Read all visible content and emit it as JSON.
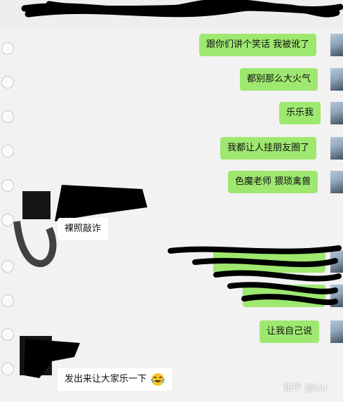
{
  "messages": [
    {
      "side": "right",
      "text": "跟你们讲个笑话 我被讹了"
    },
    {
      "side": "right",
      "text": "都别那么大火气"
    },
    {
      "side": "right",
      "text": "乐乐我"
    },
    {
      "side": "right",
      "text": "我都让人挂朋友圈了"
    },
    {
      "side": "right",
      "text": "色魔老师 猥琐禽兽"
    },
    {
      "side": "left",
      "text": "裸照敲诈"
    },
    {
      "side": "right",
      "text": "让我自己说"
    },
    {
      "side": "left",
      "text": "发出来让大家乐一下"
    }
  ],
  "emoji_icon": "laughing-tears-icon",
  "watermark": "知乎 @Liu",
  "colors": {
    "bubble_self": "#9ee870",
    "bubble_other": "#ffffff",
    "background": "#f2f2f2"
  }
}
